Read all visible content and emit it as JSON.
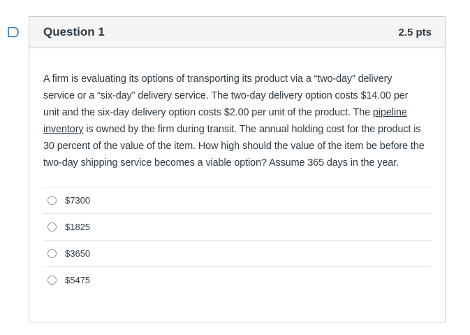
{
  "question": {
    "title": "Question 1",
    "points": "2.5 pts",
    "text_before_link": "A firm is evaluating its options of transporting its product via a “two-day” delivery service or a “six-day” delivery service.  The two-day delivery option costs $14.00 per unit and the six-day delivery option costs $2.00 per unit of the product.  The ",
    "link_text": "pipeline inventory",
    "text_after_link": " is owned by the firm during transit.  The annual holding cost for the product is 30 percent of the value of the item.  How high should the value of the item be before the two-day shipping service becomes a viable option?  Assume 365 days in the year."
  },
  "answers": [
    {
      "label": "$7300"
    },
    {
      "label": "$1825"
    },
    {
      "label": "$3650"
    },
    {
      "label": "$5475"
    }
  ],
  "icons": {
    "flag": "flag-outline-icon"
  },
  "colors": {
    "flag_accent": "#2b7abc",
    "header_bg": "#f5f5f5",
    "text": "#2d3b45"
  }
}
